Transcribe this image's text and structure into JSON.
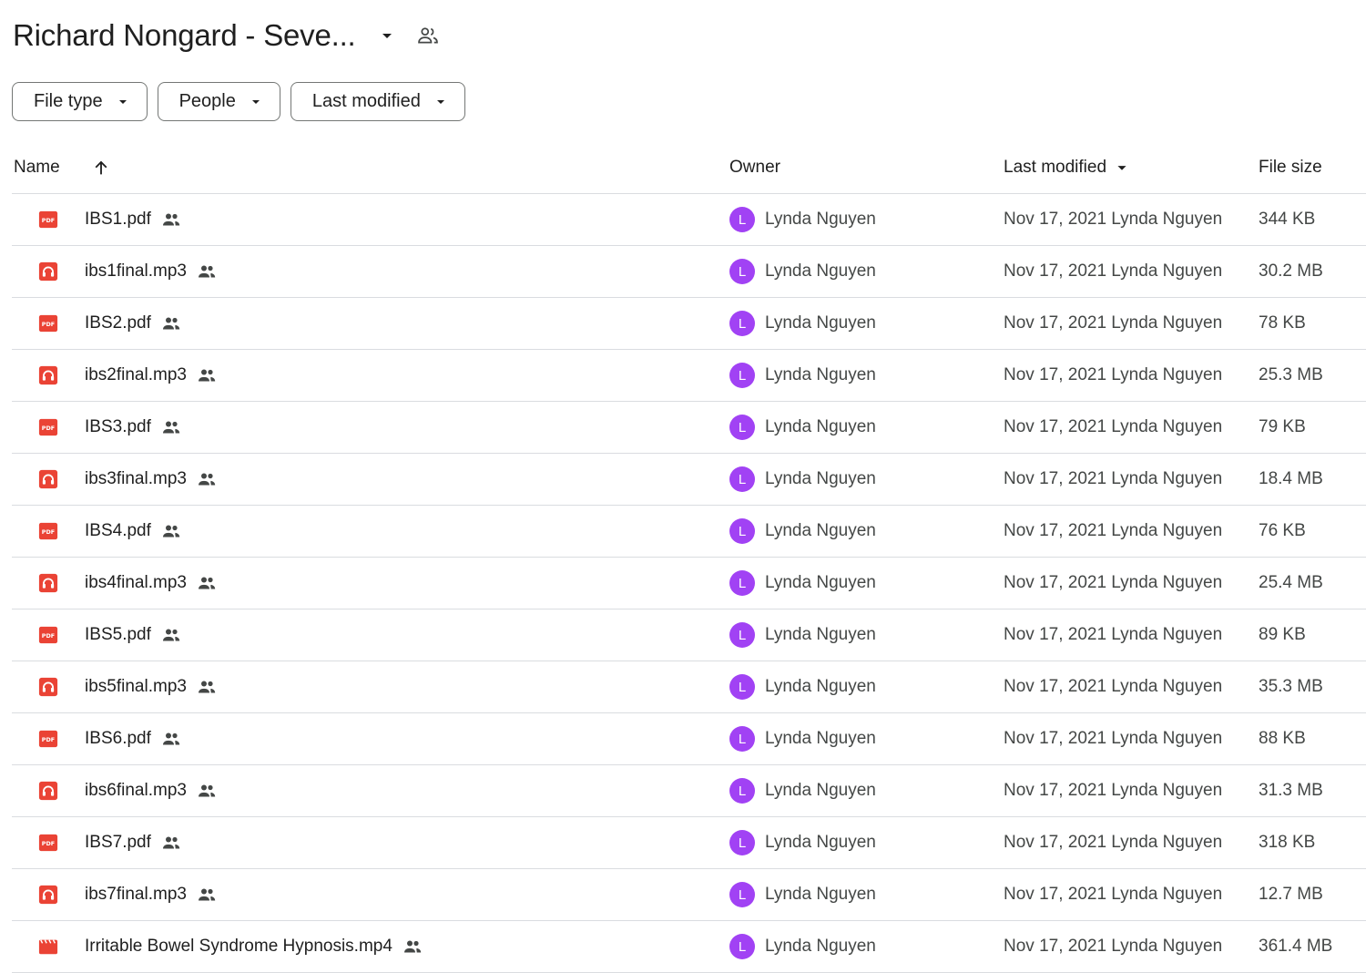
{
  "header": {
    "folder_title": "Richard Nongard - Seve..."
  },
  "filters": [
    {
      "label": "File type"
    },
    {
      "label": "People"
    },
    {
      "label": "Last modified"
    }
  ],
  "table": {
    "columns": {
      "name": "Name",
      "owner": "Owner",
      "last_modified": "Last modified",
      "file_size": "File size"
    },
    "rows": [
      {
        "name": "IBS1.pdf",
        "type": "pdf",
        "owner": "Lynda Nguyen",
        "owner_initial": "L",
        "modified": "Nov 17, 2021 Lynda Nguyen",
        "size": "344 KB"
      },
      {
        "name": "ibs1final.mp3",
        "type": "audio",
        "owner": "Lynda Nguyen",
        "owner_initial": "L",
        "modified": "Nov 17, 2021 Lynda Nguyen",
        "size": "30.2 MB"
      },
      {
        "name": "IBS2.pdf",
        "type": "pdf",
        "owner": "Lynda Nguyen",
        "owner_initial": "L",
        "modified": "Nov 17, 2021 Lynda Nguyen",
        "size": "78 KB"
      },
      {
        "name": "ibs2final.mp3",
        "type": "audio",
        "owner": "Lynda Nguyen",
        "owner_initial": "L",
        "modified": "Nov 17, 2021 Lynda Nguyen",
        "size": "25.3 MB"
      },
      {
        "name": "IBS3.pdf",
        "type": "pdf",
        "owner": "Lynda Nguyen",
        "owner_initial": "L",
        "modified": "Nov 17, 2021 Lynda Nguyen",
        "size": "79 KB"
      },
      {
        "name": "ibs3final.mp3",
        "type": "audio",
        "owner": "Lynda Nguyen",
        "owner_initial": "L",
        "modified": "Nov 17, 2021 Lynda Nguyen",
        "size": "18.4 MB"
      },
      {
        "name": "IBS4.pdf",
        "type": "pdf",
        "owner": "Lynda Nguyen",
        "owner_initial": "L",
        "modified": "Nov 17, 2021 Lynda Nguyen",
        "size": "76 KB"
      },
      {
        "name": "ibs4final.mp3",
        "type": "audio",
        "owner": "Lynda Nguyen",
        "owner_initial": "L",
        "modified": "Nov 17, 2021 Lynda Nguyen",
        "size": "25.4 MB"
      },
      {
        "name": "IBS5.pdf",
        "type": "pdf",
        "owner": "Lynda Nguyen",
        "owner_initial": "L",
        "modified": "Nov 17, 2021 Lynda Nguyen",
        "size": "89 KB"
      },
      {
        "name": "ibs5final.mp3",
        "type": "audio",
        "owner": "Lynda Nguyen",
        "owner_initial": "L",
        "modified": "Nov 17, 2021 Lynda Nguyen",
        "size": "35.3 MB"
      },
      {
        "name": "IBS6.pdf",
        "type": "pdf",
        "owner": "Lynda Nguyen",
        "owner_initial": "L",
        "modified": "Nov 17, 2021 Lynda Nguyen",
        "size": "88 KB"
      },
      {
        "name": "ibs6final.mp3",
        "type": "audio",
        "owner": "Lynda Nguyen",
        "owner_initial": "L",
        "modified": "Nov 17, 2021 Lynda Nguyen",
        "size": "31.3 MB"
      },
      {
        "name": "IBS7.pdf",
        "type": "pdf",
        "owner": "Lynda Nguyen",
        "owner_initial": "L",
        "modified": "Nov 17, 2021 Lynda Nguyen",
        "size": "318 KB"
      },
      {
        "name": "ibs7final.mp3",
        "type": "audio",
        "owner": "Lynda Nguyen",
        "owner_initial": "L",
        "modified": "Nov 17, 2021 Lynda Nguyen",
        "size": "12.7 MB"
      },
      {
        "name": "Irritable Bowel Syndrome Hypnosis.mp4",
        "type": "video",
        "owner": "Lynda Nguyen",
        "owner_initial": "L",
        "modified": "Nov 17, 2021 Lynda Nguyen",
        "size": "361.4 MB"
      }
    ]
  },
  "colors": {
    "file_icon_red": "#ea4335",
    "avatar_purple": "#a142f4",
    "border": "#dadce0",
    "text_primary": "#1f1f1f",
    "text_secondary": "#444746"
  },
  "icons": {
    "title_dropdown": "arrow-drop-down-icon",
    "folder_shared": "people-outline-icon",
    "sort": "arrow-upward-icon",
    "row_shared": "people-icon",
    "pdf": "pdf-file-icon",
    "audio": "audio-file-icon",
    "video": "video-file-icon"
  }
}
